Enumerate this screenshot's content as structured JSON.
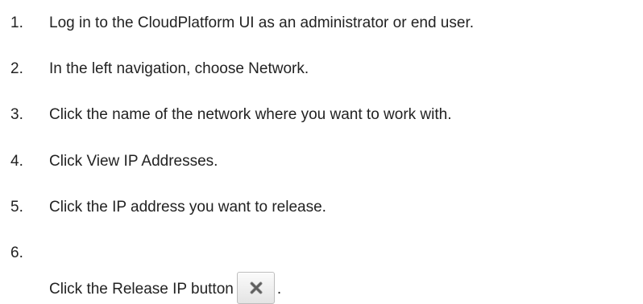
{
  "steps": [
    {
      "number": "1.",
      "text": "Log in to the CloudPlatform UI as an administrator or end user."
    },
    {
      "number": "2.",
      "text": "In the left navigation, choose Network."
    },
    {
      "number": "3.",
      "text": "Click the name of the network where you want to work with."
    },
    {
      "number": "4.",
      "text": "Click View IP Addresses."
    },
    {
      "number": "5.",
      "text": "Click the IP address you want to release."
    },
    {
      "number": "6.",
      "text": "Click the Release IP button",
      "suffix": ".",
      "icon": "close-icon"
    }
  ]
}
